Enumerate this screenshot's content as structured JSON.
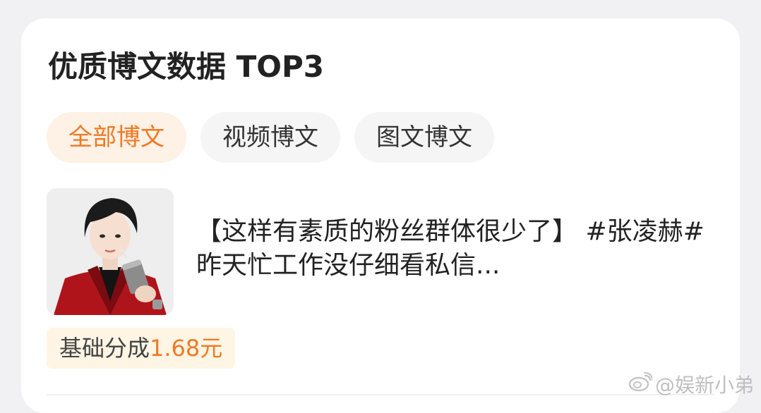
{
  "card": {
    "title": "优质博文数据 TOP3"
  },
  "tabs": [
    {
      "label": "全部博文",
      "active": true
    },
    {
      "label": "视频博文",
      "active": false
    },
    {
      "label": "图文博文",
      "active": false
    }
  ],
  "post": {
    "text": "【这样有素质的粉丝群体很少了】 #张凌赫# 昨天忙工作没仔细看私信..."
  },
  "earnings": {
    "label": "基础分成",
    "value": "1.68元"
  },
  "watermark": {
    "text": "@娱新小弟",
    "icon": "weibo-logo-icon"
  },
  "colors": {
    "accent": "#ef7a25",
    "active_tab_bg": "#fef1e5",
    "badge_bg": "#fef5e4",
    "card_bg": "#ffffff",
    "page_bg": "#f1f1f3"
  }
}
